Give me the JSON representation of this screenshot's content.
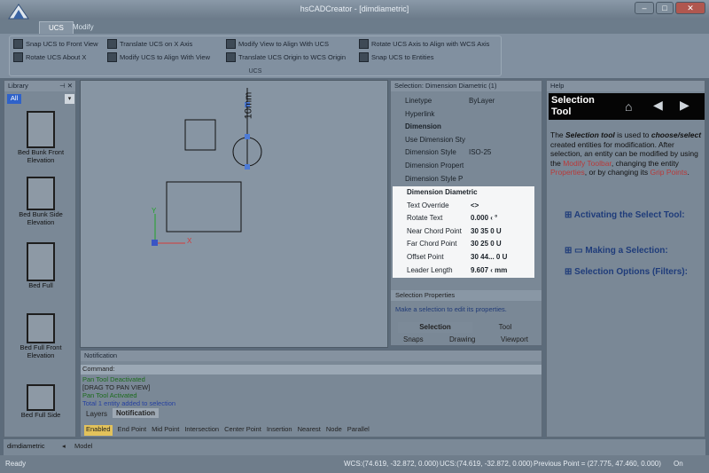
{
  "window": {
    "title": "hsCADCreator - [dimdiametric]",
    "minimize": "–",
    "maximize": "□",
    "close": "✕"
  },
  "ribbon": {
    "tabs": [
      "UCS",
      "Modify"
    ],
    "group_label": "UCS",
    "buttons": [
      "Snap UCS to Front View",
      "Translate UCS on X Axis",
      "Modify View to Align With UCS",
      "Rotate UCS Axis to Align with WCS Axis",
      "Rotate UCS About X",
      "Modify UCS to Align With View",
      "Translate UCS Origin to WCS Origin",
      "Snap UCS to Entities"
    ]
  },
  "library": {
    "title": "Library",
    "pin": "⊣ ✕",
    "filter": "All",
    "items": [
      "Bed Bunk Front Elevation",
      "Bed Bunk Side Elevation",
      "Bed Full",
      "Bed Full Front Elevation",
      "Bed Full Side"
    ]
  },
  "canvas": {
    "dimension_text": "10mm",
    "axis_x": "X",
    "axis_y": "Y"
  },
  "selection": {
    "title": "Selection: Dimension Diametric (1)",
    "rows": [
      {
        "name": "Linetype",
        "value": "ByLayer"
      },
      {
        "name": "Hyperlink",
        "value": ""
      },
      {
        "name": "Dimension",
        "value": "",
        "category": true
      },
      {
        "name": "Use Dimension Sty",
        "value": ""
      },
      {
        "name": "Dimension Style",
        "value": "ISO-25"
      },
      {
        "name": "Dimension Propert",
        "value": ""
      },
      {
        "name": "Dimension Style P",
        "value": ""
      }
    ],
    "highlight_category": "Dimension Diametric",
    "highlight_rows": [
      {
        "name": "Text Override",
        "value": "<>"
      },
      {
        "name": "Rotate Text",
        "value": "0.000 ‹ °"
      },
      {
        "name": "Near Chord Point",
        "value": "30  35  0  U"
      },
      {
        "name": "Far Chord Point",
        "value": "30  25  0  U"
      },
      {
        "name": "Offset Point",
        "value": "30  44...  0  U"
      },
      {
        "name": "Leader Length",
        "value": "9.607 ‹ mm"
      }
    ],
    "props_header": "Selection Properties",
    "props_hint": "Make a selection to edit its properties.",
    "modes": [
      "Selection",
      "Tool"
    ],
    "tabs": [
      "Snaps",
      "Drawing",
      "Viewport"
    ]
  },
  "help": {
    "title": "Help",
    "banner": "Selection Tool",
    "body_intro": "The ",
    "body_bold": "Selection tool",
    "body_mid": " is used to ",
    "body_em": "choose/select",
    "body_rest": " created entities for modification. After selection, an entity can be modified by using the ",
    "link1": "Modify Toolbar",
    "body_rest2": ", changing the entity ",
    "link2": "Properties",
    "body_rest3": ", or by changing its ",
    "link3": "Grip Points",
    "body_end": ".",
    "sections": [
      "Activating the Select Tool:",
      "Making a Selection:",
      "Selection Options (Filters):"
    ]
  },
  "notification": {
    "title": "Notification",
    "command_label": "Command:",
    "lines": [
      "Pan Tool Deactivated",
      "[DRAG TO PAN VIEW]",
      "Pan Tool Activated",
      "Total 1 entity added to selection"
    ],
    "tabs": [
      "Layers",
      "Notification"
    ],
    "snaps": [
      "Enabled",
      "End Point",
      "Mid Point",
      "Intersection",
      "Center Point",
      "Insertion",
      "Nearest",
      "Node",
      "Parallel"
    ]
  },
  "doc": {
    "tab": "dimdiametric",
    "model": "Model"
  },
  "status": {
    "left": "Ready",
    "wcs": "WCS:(74.619, -32.872, 0.000)",
    "ucs": "UCS:(74.619, -32.872, 0.000)",
    "prev": "Previous Point = (27.775, 47.460, 0.000)",
    "mode": "On"
  }
}
